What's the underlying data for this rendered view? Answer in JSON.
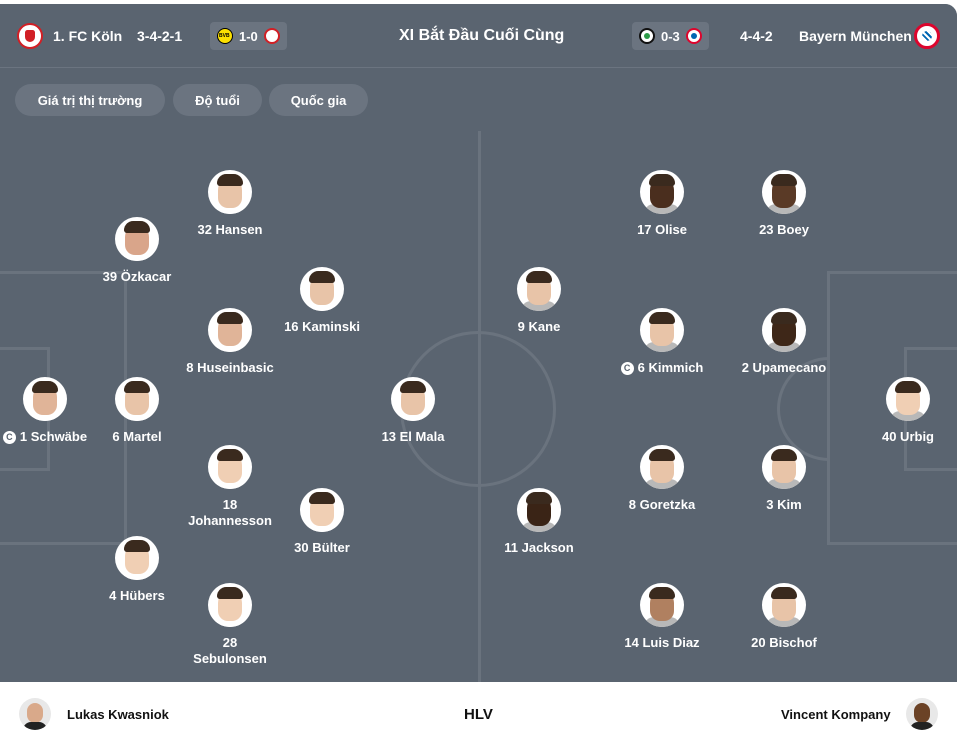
{
  "header": {
    "home_team": "1. FC Köln",
    "home_formation": "3-4-2-1",
    "home_last_result": "1-0",
    "title": "XI Bắt Đầu Cuối Cùng",
    "away_last_result": "0-3",
    "away_formation": "4-4-2",
    "away_team": "Bayern München",
    "home_crest_icon": "fc-koln-crest-icon",
    "away_crest_icon": "bayern-crest-icon"
  },
  "tabs": [
    "Giá trị thị trường",
    "Độ tuổi",
    "Quốc gia"
  ],
  "captain_badge": "C",
  "home_players": [
    {
      "label": "32 Hansen"
    },
    {
      "label": "39 Özkacar"
    },
    {
      "label": "16 Kaminski"
    },
    {
      "label": "8 Huseinbasic"
    },
    {
      "label": "1 Schwäbe",
      "captain": true
    },
    {
      "label": "6 Martel"
    },
    {
      "label": "13 El Mala"
    },
    {
      "label": "18 Johannesson"
    },
    {
      "label": "30 Bülter"
    },
    {
      "label": "4 Hübers"
    },
    {
      "label": "28 Sebulonsen"
    }
  ],
  "away_players": [
    {
      "label": "17 Olise"
    },
    {
      "label": "23 Boey"
    },
    {
      "label": "9 Kane"
    },
    {
      "label": "6 Kimmich",
      "captain": true
    },
    {
      "label": "2 Upamecano"
    },
    {
      "label": "40 Urbig"
    },
    {
      "label": "8 Goretzka"
    },
    {
      "label": "3 Kim"
    },
    {
      "label": "11 Jackson"
    },
    {
      "label": "14 Luis Diaz"
    },
    {
      "label": "20 Bischof"
    }
  ],
  "footer": {
    "home_coach": "Lukas Kwasniok",
    "label": "HLV",
    "away_coach": "Vincent Kompany"
  },
  "colors": {
    "pitch": "#5a6470",
    "pitch_lines": "#6a737e",
    "pill": "#6b7480",
    "koln_red": "#d11f25",
    "bayern_red": "#dc052d"
  }
}
